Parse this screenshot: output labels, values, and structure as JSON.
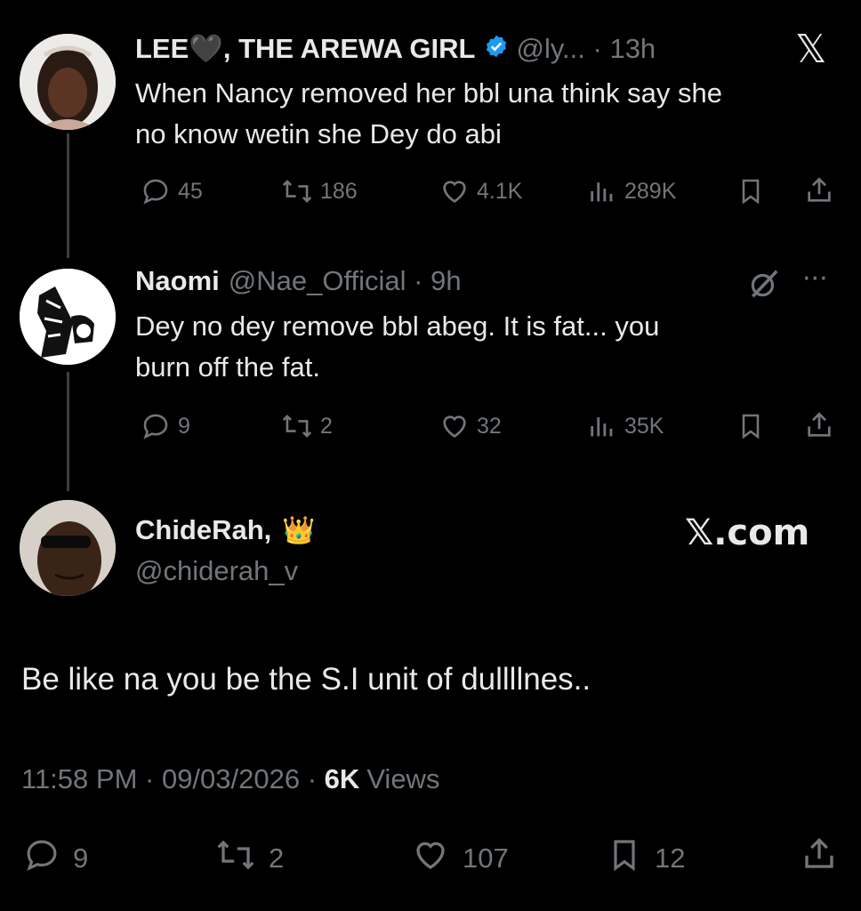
{
  "tweet1": {
    "name": "LEE🖤, THE AREWA GIRL",
    "handle": "@ly...",
    "time": "13h",
    "text": "When Nancy removed her bbl una think say she\nno know wetin she Dey do abi",
    "replies": "45",
    "retweets": "186",
    "likes": "4.1K",
    "views": "289K",
    "x_logo": "𝕏"
  },
  "tweet2": {
    "name": "Naomi",
    "handle": "@Nae_Official",
    "time": "9h",
    "text": "Dey no dey remove bbl abeg. It is fat... you\nburn off the fat.",
    "replies": "9",
    "retweets": "2",
    "likes": "32",
    "views": "35K",
    "more": "···"
  },
  "tweet3": {
    "name": "ChideRah,",
    "emoji": "👑",
    "handle": "@chiderah_v",
    "source_brand": "𝕏.com",
    "text": "Be like na you be the S.I unit of dullllnes..",
    "time": "11:58 PM",
    "date": "09/03/2026",
    "views_count": "6K",
    "views_label": "Views",
    "replies": "9",
    "retweets": "2",
    "likes": "107",
    "bookmarks": "12"
  },
  "colors": {
    "background": "#000000",
    "text": "#e7e9ea",
    "muted": "#71767b",
    "verified": "#1d9bf0"
  }
}
